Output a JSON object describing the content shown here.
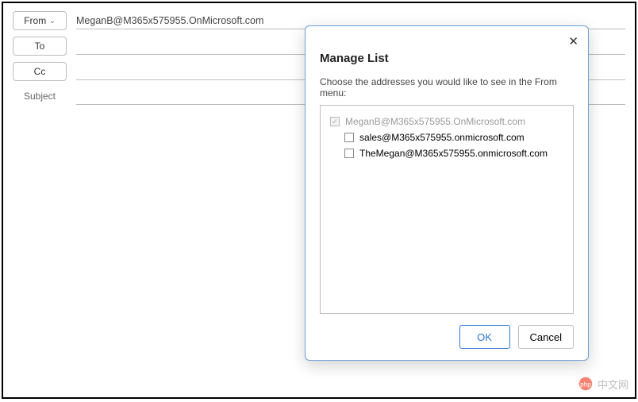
{
  "compose": {
    "from_label": "From",
    "from_value": "MeganB@M365x575955.OnMicrosoft.com",
    "to_label": "To",
    "cc_label": "Cc",
    "subject_label": "Subject"
  },
  "dialog": {
    "title": "Manage List",
    "instruction": "Choose the addresses you would like to see in the From menu:",
    "addresses": [
      {
        "email": "MeganB@M365x575955.OnMicrosoft.com",
        "checked": true,
        "disabled": true,
        "indent": false
      },
      {
        "email": "sales@M365x575955.onmicrosoft.com",
        "checked": false,
        "disabled": false,
        "indent": true
      },
      {
        "email": "TheMegan@M365x575955.onmicrosoft.com",
        "checked": false,
        "disabled": false,
        "indent": true
      }
    ],
    "ok_label": "OK",
    "cancel_label": "Cancel"
  },
  "watermark": {
    "text": "中文网",
    "prefix": "php"
  }
}
